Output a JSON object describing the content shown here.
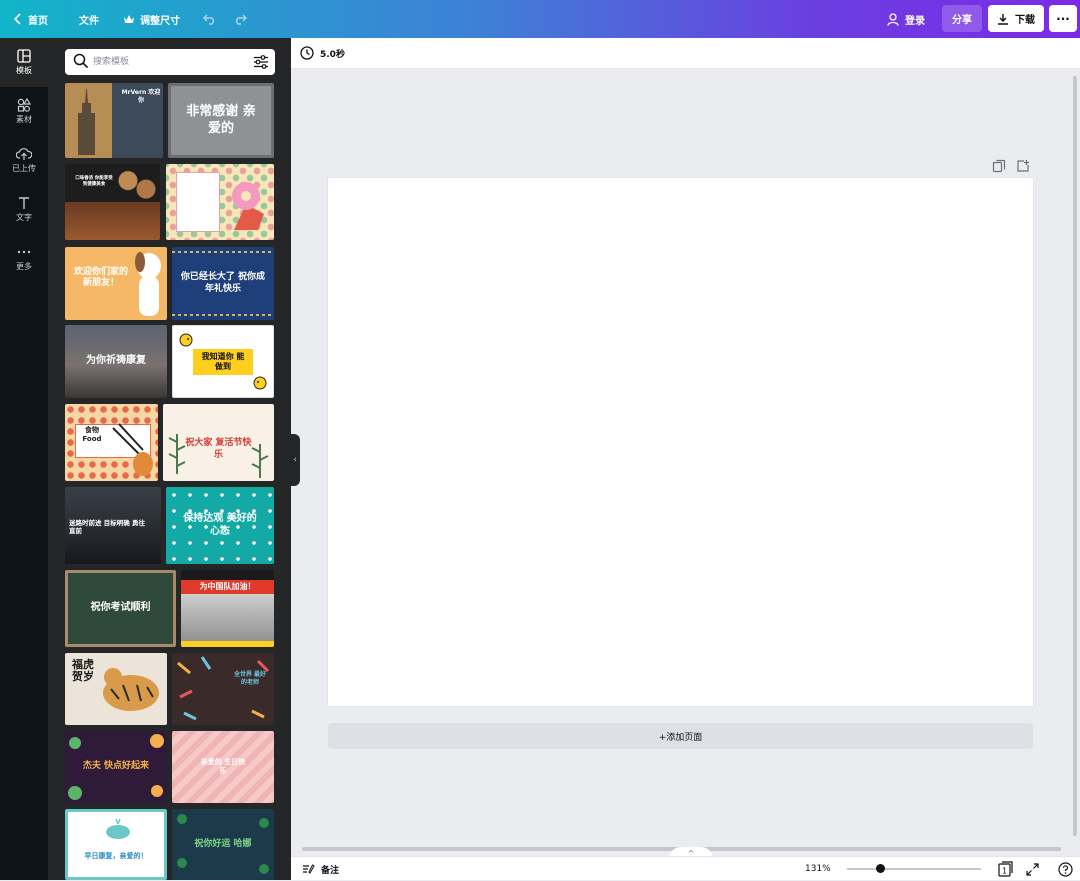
{
  "topbar": {
    "home_label": "首页",
    "file_label": "文件",
    "resize_label": "调整尺寸",
    "login_label": "登录",
    "share_label": "分享",
    "download_label": "下载",
    "more_label": "···"
  },
  "sidenav": {
    "items": [
      {
        "label": "模板",
        "icon": "template-icon"
      },
      {
        "label": "素材",
        "icon": "elements-icon"
      },
      {
        "label": "已上传",
        "icon": "upload-icon"
      },
      {
        "label": "文字",
        "icon": "text-icon"
      },
      {
        "label": "更多",
        "icon": "more-icon"
      }
    ]
  },
  "panel": {
    "search_placeholder": "搜索模板",
    "templates": [
      {
        "text": "MrVern 欢迎你"
      },
      {
        "text": "非常感谢 亲爱的"
      },
      {
        "text": "口味香浓 你能享受到健康美食"
      },
      {
        "text": ""
      },
      {
        "text": "欢迎你们家的 新朋友！"
      },
      {
        "text": "你已经长大了 祝你成年礼快乐"
      },
      {
        "text": "为你祈祷康复"
      },
      {
        "text": "我知道你 能做到"
      },
      {
        "text": "食物 Food"
      },
      {
        "text": "祝大家 复活节快乐"
      },
      {
        "text": "迷路时前进 目标明确 勇往直前"
      },
      {
        "text": "保持达观 美好的心态"
      },
      {
        "text": "祝你考试顺利"
      },
      {
        "text": "为中国队加油！"
      },
      {
        "text": "福虎贺岁"
      },
      {
        "text": "全世界 最好 的老师"
      },
      {
        "text": "杰夫 快点好起来"
      },
      {
        "text": "亲爱的 生日快乐"
      },
      {
        "text": "早日康复，亲爱的！"
      },
      {
        "text": "祝你好运 哈娜"
      }
    ]
  },
  "editor": {
    "duration": "5.0秒",
    "add_page_label": "+添加页面",
    "notes_label": "备注",
    "zoom": "131%",
    "page_count": "1"
  },
  "colors": {
    "brand_start": "#12b4c9",
    "brand_end": "#7d2ae8",
    "sidebar": "#0e1318",
    "panel": "#252627",
    "workspace": "#ebecf0"
  }
}
